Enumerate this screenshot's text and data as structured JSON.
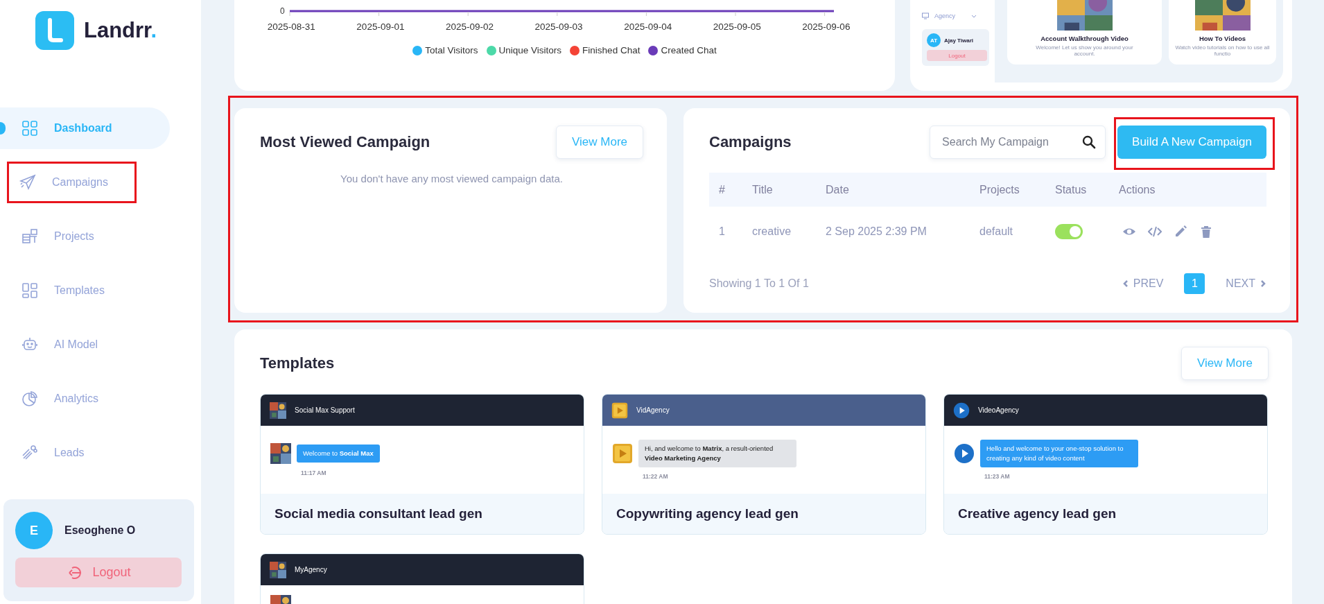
{
  "logo": {
    "name": "Landrr",
    "mark": "."
  },
  "nav": [
    {
      "label": "Dashboard",
      "selected": true,
      "highlighted": false
    },
    {
      "label": "Campaigns",
      "selected": false,
      "highlighted": true
    },
    {
      "label": "Projects",
      "selected": false,
      "highlighted": false
    },
    {
      "label": "Templates",
      "selected": false,
      "highlighted": false
    },
    {
      "label": "AI Model",
      "selected": false,
      "highlighted": false
    },
    {
      "label": "Analytics",
      "selected": false,
      "highlighted": false
    },
    {
      "label": "Leads",
      "selected": false,
      "highlighted": false
    }
  ],
  "user": {
    "initial": "E",
    "name": "Eseoghene O",
    "logout": "Logout"
  },
  "visitors_chart": {
    "y_tick": "0",
    "x_labels": [
      "2025-08-31",
      "2025-09-01",
      "2025-09-02",
      "2025-09-03",
      "2025-09-04",
      "2025-09-05",
      "2025-09-06"
    ],
    "legend": [
      {
        "label": "Total Visitors",
        "color": "#29b6f6"
      },
      {
        "label": "Unique Visitors",
        "color": "#4cd9a8"
      },
      {
        "label": "Finished Chat",
        "color": "#f44336"
      },
      {
        "label": "Created Chat",
        "color": "#6a3bb8"
      }
    ]
  },
  "guide_panel": {
    "menu_item": "Agency",
    "user": {
      "initials": "AT",
      "name": "Ajay Tiwari",
      "logout": "Logout"
    },
    "cards": [
      {
        "title": "Account Walkthrough Video",
        "description": "Welcome! Let us show you around your account."
      },
      {
        "title": "How To Videos",
        "description": "Watch video tutorials on how to use all functio"
      }
    ]
  },
  "highlight_row": {
    "highlighted": true
  },
  "most_viewed": {
    "title": "Most Viewed Campaign",
    "button": "View More",
    "empty_message": "You don't have any most viewed campaign data."
  },
  "campaigns": {
    "title": "Campaigns",
    "search": {
      "placeholder": "Search My Campaign"
    },
    "button": {
      "label": "Build A New Campaign",
      "highlighted": true
    },
    "columns": [
      "#",
      "Title",
      "Date",
      "Projects",
      "Status",
      "Actions"
    ],
    "rows": [
      {
        "number": "1",
        "title": "creative",
        "date": "2 Sep 2025 2:39 PM",
        "project": "default",
        "on": true
      }
    ],
    "summary": "Showing 1 To 1 Of 1",
    "pagination": {
      "prev": "PREV",
      "pages": [
        {
          "label": "1",
          "selected": true
        }
      ],
      "next": "NEXT"
    }
  },
  "templates": {
    "title": "Templates",
    "button": "View More",
    "items": [
      {
        "bot_name": "Social Max Support",
        "color": "#1e2433",
        "bubble": {
          "text": "Welcome to **Social Max**",
          "color": "#2d9cf4"
        },
        "time": "11:17 AM",
        "title": "Social media consultant lead gen"
      },
      {
        "bot_name": "VidAgency",
        "color": "#4a5f8c",
        "avatar": {
          "kind": "play-square"
        },
        "bubble": {
          "text": "Hi, and welcome to **Matrix**, a result-oriented **Video Marketing Agency**",
          "color": "#e2e4e8"
        },
        "time": "11:22 AM",
        "title": "Copywriting agency lead gen"
      },
      {
        "bot_name": "VideoAgency",
        "color": "#1e2433",
        "avatar": {
          "kind": "play-circle"
        },
        "bubble": {
          "text": "Hello and welcome to your one-stop solution to creating any kind of video content",
          "color": "#2d9cf4"
        },
        "time": "11:23 AM",
        "title": "Creative agency lead gen"
      },
      {
        "bot_name": "MyAgency",
        "color": "#1e2433"
      }
    ]
  }
}
